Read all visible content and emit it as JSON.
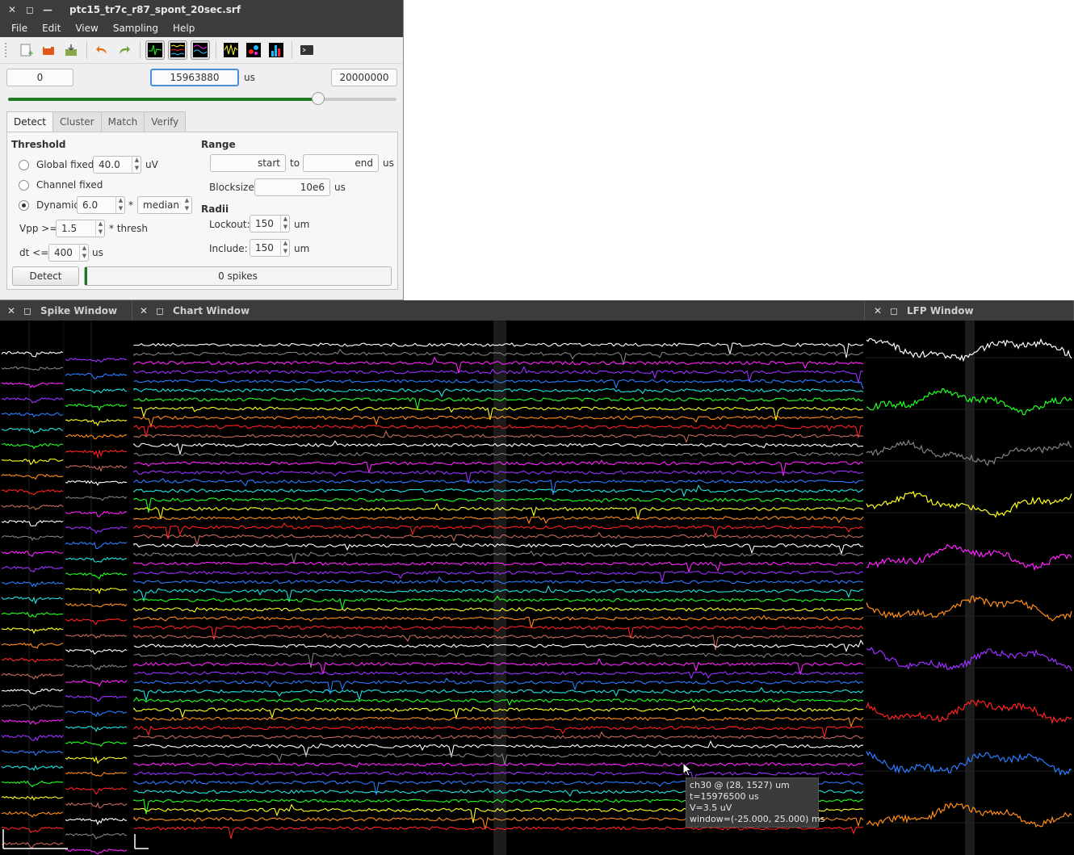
{
  "main_window": {
    "title": "ptc15_tr7c_r87_spont_20sec.srf",
    "menu": [
      "File",
      "Edit",
      "View",
      "Sampling",
      "Help"
    ],
    "toolbar_icons": [
      "new-file-icon",
      "open-folder-icon",
      "save-icon",
      "undo-icon",
      "redo-icon",
      "spike-window-icon",
      "chart-window-icon",
      "lfp-window-icon",
      "sort-icon",
      "cluster-icon",
      "histogram-icon",
      "terminal-icon"
    ],
    "time": {
      "start": "0",
      "current": "15963880",
      "unit": "us",
      "end": "20000000",
      "position_fraction": 0.798
    },
    "tabs": [
      "Detect",
      "Cluster",
      "Match",
      "Verify"
    ],
    "detect": {
      "threshold_heading": "Threshold",
      "global_fixed_label": "Global fixed",
      "global_fixed_value": "40.0",
      "global_unit": "uV",
      "channel_fixed_label": "Channel fixed",
      "dynamic_label": "Dynamic",
      "dynamic_value": "6.0",
      "dynamic_op": "*",
      "dynamic_method": "median",
      "vpp_label": "Vpp >=",
      "vpp_value": "1.5",
      "vpp_suffix": "* thresh",
      "dt_label": "dt <=",
      "dt_value": "400",
      "dt_unit": "us",
      "range_heading": "Range",
      "range_start": "start",
      "range_to": "to",
      "range_end": "end",
      "range_unit": "us",
      "blocksize_label": "Blocksize:",
      "blocksize_value": "10e6",
      "blocksize_unit": "us",
      "radii_heading": "Radii",
      "lockout_label": "Lockout:",
      "lockout_value": "150",
      "lockout_unit": "um",
      "include_label": "Include:",
      "include_value": "150",
      "include_unit": "um",
      "detect_button": "Detect",
      "progress_text": "0 spikes",
      "selected_threshold": "Dynamic"
    }
  },
  "panes": {
    "spike": {
      "title": "Spike Window"
    },
    "chart": {
      "title": "Chart Window"
    },
    "lfp": {
      "title": "LFP Window"
    }
  },
  "tooltip": {
    "line1": "ch30 @ (28, 1527) um",
    "line2": "t=15976500 us",
    "line3": "V=3.5 uV",
    "line4": "window=(-25.000, 25.000) ms"
  },
  "colors": {
    "channel_cycle": [
      "#ffffff",
      "#808080",
      "#ff22ff",
      "#9b30ff",
      "#2b7cff",
      "#22e0e0",
      "#22ff22",
      "#ffff22",
      "#ff8c1a",
      "#ff2222",
      "#c46a5a"
    ],
    "lfp_cycle": [
      "#ffffff",
      "#22ff22",
      "#808080",
      "#ffff22",
      "#ff22ff",
      "#ff8c1a",
      "#9b30ff",
      "#ff2222",
      "#2b7cff",
      "#ff8c1a"
    ],
    "accent_green": "#1f7a1f"
  }
}
